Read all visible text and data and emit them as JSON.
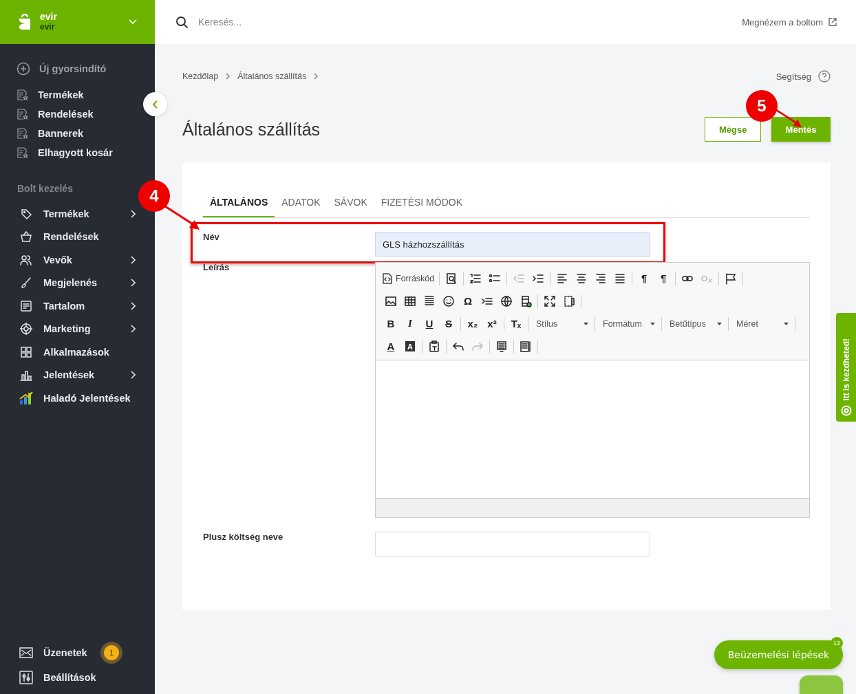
{
  "store": {
    "name": "evir",
    "email": "evir"
  },
  "quick_add": "Új gyorsindító",
  "quick_links": [
    "Termékek",
    "Rendelések",
    "Bannerek",
    "Elhagyott kosár"
  ],
  "section_title": "Bolt kezelés",
  "nav": [
    {
      "label": "Termékek",
      "expandable": true
    },
    {
      "label": "Rendelések",
      "expandable": false
    },
    {
      "label": "Vevők",
      "expandable": true
    },
    {
      "label": "Megjelenés",
      "expandable": true
    },
    {
      "label": "Tartalom",
      "expandable": true
    },
    {
      "label": "Marketing",
      "expandable": true
    },
    {
      "label": "Alkalmazások",
      "expandable": false
    },
    {
      "label": "Jelentések",
      "expandable": true
    },
    {
      "label": "Haladó Jelentések",
      "expandable": false
    }
  ],
  "bottom_nav": [
    {
      "label": "Üzenetek",
      "badge": "1"
    },
    {
      "label": "Beállítások"
    }
  ],
  "search": {
    "placeholder": "Keresés..."
  },
  "view_store": "Megnézem a boltom",
  "breadcrumb": [
    "Kezdőlap",
    "Általános szállítás"
  ],
  "help": "Segítség",
  "title": "Általános szállítás",
  "buttons": {
    "cancel": "Mégse",
    "save": "Mentés"
  },
  "tabs": [
    {
      "label": "ÁLTALÁNOS",
      "selected": true
    },
    {
      "label": "ADATOK",
      "selected": false
    },
    {
      "label": "SÁVOK",
      "selected": false
    },
    {
      "label": "FIZETÉSI MÓDOK",
      "selected": false
    }
  ],
  "fields": [
    {
      "label": "Név",
      "kind": "text",
      "value": "GLS házhozszállítás",
      "highlighted": true
    },
    {
      "label": "Leírás",
      "kind": "editor",
      "highlighted": false
    },
    {
      "label": "Plusz költség neve",
      "kind": "text",
      "highlighted": false
    }
  ],
  "editor": {
    "source_label": "Forráskód",
    "glyphs": [
      "¶",
      "¶",
      "Ω",
      "B",
      "I",
      "U",
      "S",
      "x₂",
      "x²",
      "Tₓ",
      "A",
      "A"
    ],
    "dropdowns": [
      "Stílus",
      "Formátum",
      "Betűtípus",
      "Méret"
    ]
  },
  "annotations": [
    {
      "label": "4"
    },
    {
      "label": "5"
    }
  ],
  "side_tab": "Itt is kezdheted!",
  "setup_button": {
    "label": "Beüzemelési lépések",
    "count": "12"
  }
}
